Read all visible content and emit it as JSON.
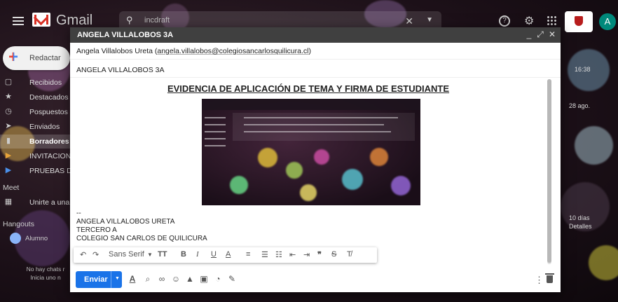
{
  "gmail": {
    "logo_text": "Gmail",
    "search_text": "incdraft",
    "help_label": "?",
    "avatar_letter": "A"
  },
  "sidebar": {
    "compose_label": "Redactar",
    "items": [
      {
        "label": "Recibidos",
        "icon": "inbox-icon",
        "glyph": "▢"
      },
      {
        "label": "Destacados",
        "icon": "star-icon",
        "glyph": "★"
      },
      {
        "label": "Pospuestos",
        "icon": "clock-icon",
        "glyph": "◷"
      },
      {
        "label": "Enviados",
        "icon": "send-icon",
        "glyph": "➤"
      },
      {
        "label": "Borradores",
        "icon": "draft-icon",
        "glyph": "▮"
      },
      {
        "label": "INVITACIONE",
        "icon": "label-icon",
        "glyph": "▶"
      },
      {
        "label": "PRUEBAS DE",
        "icon": "label-icon",
        "glyph": "▶"
      }
    ],
    "meet_label": "Meet",
    "join_label": "Unirte a una r",
    "hangouts_label": "Hangouts",
    "hangout_user": "Alumno",
    "no_chats_line1": "No hay chats r",
    "no_chats_line2": "Inicia uno n"
  },
  "right_list": {
    "date1": "16:38",
    "date2": "28 ago.",
    "date3": "10 días",
    "date4": "Detalles"
  },
  "compose": {
    "title": "ANGELA VILLALOBOS 3A",
    "to_name": "Angela Villalobos Ureta (",
    "to_email": "angela.villalobos@colegiosancarlosquilicura.cl",
    "to_close": ")",
    "subject": "ANGELA VILLALOBOS 3A",
    "doc_title": "EVIDENCIA DE APLICACIÓN DE TEMA Y FIRMA DE ESTUDIANTE",
    "sig_dash": "--",
    "sig_line1": "ANGELA VILLALOBOS URETA",
    "sig_line2": "TERCERO A",
    "sig_line3": "COLEGIO SAN CARLOS DE QUILICURA",
    "font_name": "Sans Serif",
    "send_label": "Enviar"
  },
  "colors": {
    "send_blue": "#1a73e8",
    "header_dark": "#404040"
  }
}
